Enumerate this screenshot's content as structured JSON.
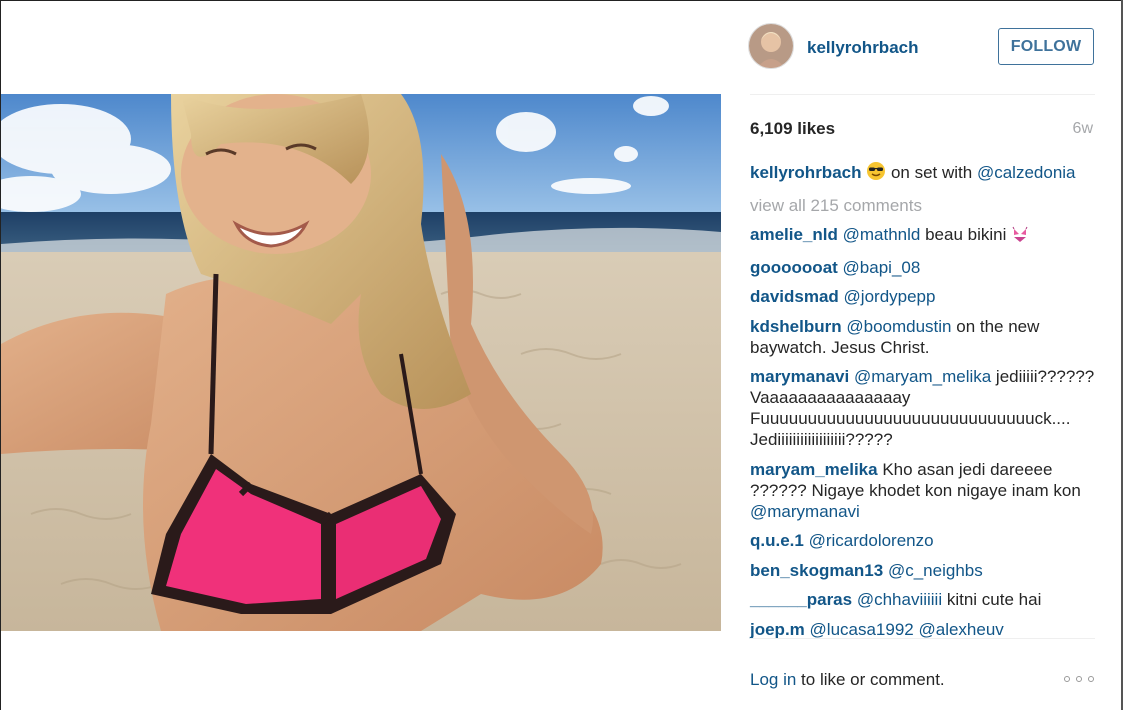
{
  "post": {
    "username": "kellyrohrbach",
    "follow_label": "FOLLOW",
    "likes": "6,109 likes",
    "time_ago": "6w",
    "caption": {
      "user": "kellyrohrbach",
      "text_before": "on set with",
      "mention": "@calzedonia",
      "emoji_icon": "sunglasses-emoji"
    },
    "view_all": "view all 215 comments"
  },
  "comments": [
    {
      "user": "amelie_nld",
      "parts": [
        {
          "t": "@mathnld",
          "m": true
        },
        {
          "t": " beau bikini ",
          "m": false
        }
      ],
      "emoji_icon": "bikini-emoji"
    },
    {
      "user": "gooooooat",
      "parts": [
        {
          "t": "@bapi_08",
          "m": true
        }
      ]
    },
    {
      "user": "davidsmad",
      "parts": [
        {
          "t": "@jordypepp",
          "m": true
        }
      ]
    },
    {
      "user": "kdshelburn",
      "parts": [
        {
          "t": "@boomdustin",
          "m": true
        },
        {
          "t": " on the new baywatch. Jesus Christ.",
          "m": false
        }
      ]
    },
    {
      "user": "marymanavi",
      "parts": [
        {
          "t": "@maryam_melika",
          "m": true
        },
        {
          "t": " jediiiii?????? Vaaaaaaaaaaaaaaay Fuuuuuuuuuuuuuuuuuuuuuuuuuuuuuck.... Jediiiiiiiiiiiiiiiiii?????",
          "m": false
        }
      ]
    },
    {
      "user": "maryam_melika",
      "parts": [
        {
          "t": " Kho asan jedi dareeee ?????? Nigaye khodet kon nigaye inam kon ",
          "m": false
        },
        {
          "t": "@marymanavi",
          "m": true
        }
      ]
    },
    {
      "user": "q.u.e.1",
      "parts": [
        {
          "t": "@ricardolorenzo",
          "m": true
        }
      ]
    },
    {
      "user": "ben_skogman13",
      "parts": [
        {
          "t": "@c_neighbs",
          "m": true
        }
      ]
    },
    {
      "user": "______paras",
      "parts": [
        {
          "t": "@chhaviiiiii",
          "m": true
        },
        {
          "t": " kitni cute hai",
          "m": false
        }
      ]
    },
    {
      "user": "joep.m",
      "parts": [
        {
          "t": "@lucasa1992",
          "m": true
        },
        {
          "t": " ",
          "m": false
        },
        {
          "t": "@alexheuv",
          "m": true
        }
      ]
    }
  ],
  "footer": {
    "login_link": "Log in",
    "login_rest": " to like or comment.",
    "more_icon": "more-options-icon"
  },
  "colors": {
    "link": "#125688",
    "follow": "#3f729b",
    "muted": "#a5a7aa",
    "bikini": "#f0317a"
  }
}
